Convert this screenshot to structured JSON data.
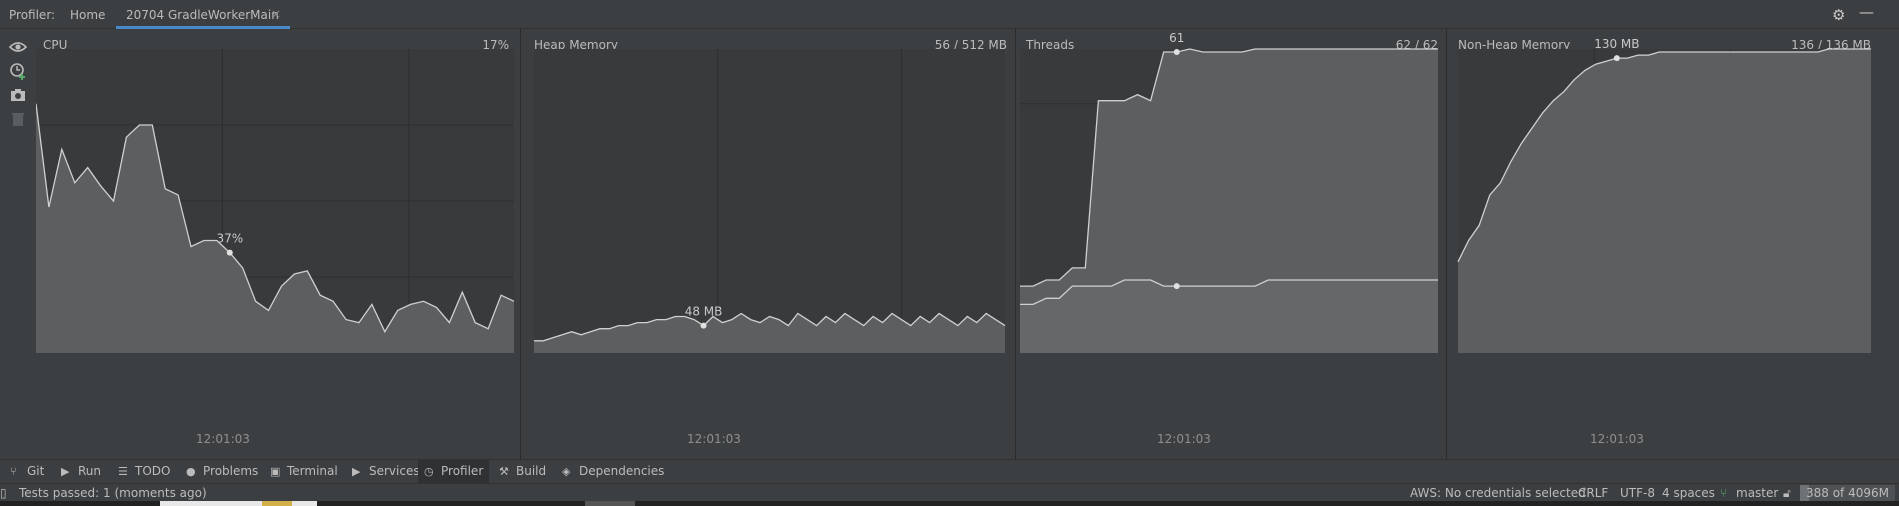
{
  "header": {
    "profiler_label": "Profiler:",
    "home_tab": "Home",
    "session_tab": "20704 GradleWorkerMain",
    "close_glyph": "×"
  },
  "left_tools": [
    "eye-icon",
    "add-session-icon",
    "camera-icon",
    "trash-icon"
  ],
  "panels": {
    "cpu": {
      "title": "CPU",
      "value": "17%",
      "time": "12:01:03",
      "marker_label": "37%",
      "series": [
        82,
        48,
        67,
        56,
        61,
        55,
        50,
        71,
        75,
        75,
        54,
        52,
        35,
        37,
        37,
        33,
        28,
        17,
        14,
        22,
        26,
        27,
        19,
        17,
        11,
        10,
        16,
        7,
        14,
        16,
        17,
        15,
        10,
        20,
        10,
        8,
        19,
        17
      ]
    },
    "heap": {
      "title": "Heap Memory",
      "value": "56 / 512 MB",
      "time": "12:01:03",
      "marker_label": "48 MB",
      "series": [
        4,
        4,
        5,
        6,
        7,
        6,
        7,
        8,
        8,
        9,
        9,
        10,
        10,
        11,
        11,
        12,
        12,
        11,
        9,
        12,
        10,
        11,
        13,
        11,
        10,
        12,
        11,
        9,
        13,
        11,
        9,
        12,
        10,
        13,
        11,
        9,
        12,
        10,
        13,
        11,
        9,
        12,
        10,
        13,
        11,
        9,
        12,
        10,
        13,
        11,
        9
      ]
    },
    "threads": {
      "title": "Threads",
      "value": "62 / 62",
      "time": "12:01:03",
      "marker_label": "61",
      "top_series": [
        22,
        22,
        24,
        24,
        28,
        28,
        83,
        83,
        83,
        85,
        83,
        99,
        99,
        100,
        99,
        99,
        99,
        99,
        100,
        100,
        100,
        100,
        100,
        100,
        100,
        100,
        100,
        100,
        100,
        100,
        100,
        100,
        100
      ],
      "bottom_series": [
        16,
        16,
        18,
        18,
        22,
        22,
        22,
        22,
        24,
        24,
        24,
        22,
        22,
        22,
        22,
        22,
        22,
        22,
        22,
        24,
        24,
        24,
        24,
        24,
        24,
        24,
        24,
        24,
        24,
        24,
        24,
        24,
        24
      ]
    },
    "nonheap": {
      "title": "Non-Heap Memory",
      "value": "136 / 136 MB",
      "time": "12:01:03",
      "marker_label": "130 MB",
      "series": [
        30,
        37,
        42,
        52,
        56,
        63,
        69,
        74,
        79,
        83,
        86,
        90,
        93,
        95,
        96,
        97,
        97,
        98,
        98,
        99,
        99,
        99,
        99,
        99,
        99,
        99,
        99,
        99,
        99,
        99,
        99,
        99,
        99,
        99,
        99,
        100,
        100,
        100,
        100,
        100
      ]
    }
  },
  "tool_tabs": [
    {
      "label": "Git",
      "icon": "git-branch-icon"
    },
    {
      "label": "Run",
      "icon": "run-icon"
    },
    {
      "label": "TODO",
      "icon": "todo-list-icon"
    },
    {
      "label": "Problems",
      "icon": "problems-icon"
    },
    {
      "label": "Terminal",
      "icon": "terminal-icon"
    },
    {
      "label": "Services",
      "icon": "services-icon"
    },
    {
      "label": "Profiler",
      "icon": "profiler-icon"
    },
    {
      "label": "Build",
      "icon": "build-hammer-icon"
    },
    {
      "label": "Dependencies",
      "icon": "dependencies-icon"
    }
  ],
  "status": {
    "tests": "Tests passed: 1 (moments ago)",
    "aws": "AWS: No credentials selected",
    "line_sep": "CRLF",
    "encoding": "UTF-8",
    "indent": "4 spaces",
    "branch": "master",
    "memory": "388 of 4096M",
    "memory_fraction": 0.095
  },
  "colors": {
    "accent_tab": "#4a88c7",
    "chart_fill": "#5d5e5f",
    "chart_line": "#d0d0d0",
    "chart_bg": "#383a3c"
  }
}
